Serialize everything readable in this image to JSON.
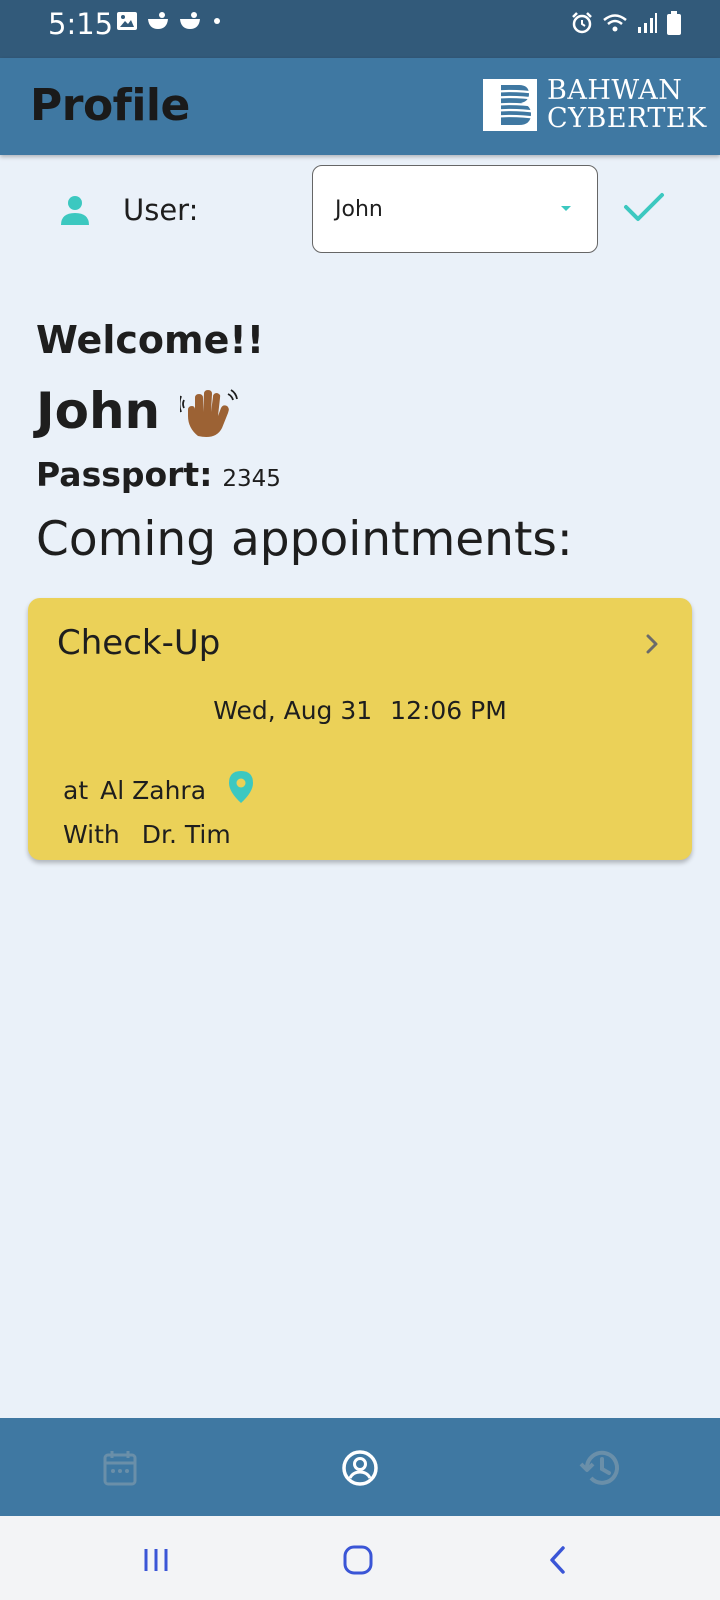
{
  "status_bar": {
    "time": "5:15",
    "icons_left": [
      "image-icon",
      "notification-app-icon",
      "notification-app-icon",
      "more-dot-icon"
    ],
    "icons_right": [
      "alarm-icon",
      "wifi-icon",
      "signal-icon",
      "battery-icon"
    ]
  },
  "app_bar": {
    "title": "Profile",
    "logo_line1": "BAHWAN",
    "logo_line2": "CYBERTEK"
  },
  "user_select": {
    "label": "User:",
    "selected": "John",
    "icon": "person-icon",
    "confirm_icon": "check-icon"
  },
  "welcome": {
    "greeting": "Welcome!!",
    "name": "John",
    "emoji_icon": "waving-hand-icon",
    "passport_label": "Passport:",
    "passport_value": "2345",
    "section_title": "Coming appointments:"
  },
  "appointments": [
    {
      "type": "Check-Up",
      "date": "Wed, Aug 31",
      "time": "12:06 PM",
      "location_prefix": "at",
      "location": "Al Zahra",
      "doctor_prefix": "With",
      "doctor": "Dr. Tim"
    }
  ],
  "bottom_nav": {
    "items": [
      "calendar-icon",
      "account-circle-icon",
      "history-icon"
    ],
    "active": "account-circle-icon"
  },
  "colors": {
    "status_bar": "#325a7a",
    "app_bar": "#3f78a2",
    "background": "#eaf1f9",
    "card": "#ebd158",
    "accent": "#3cc8c0",
    "system_nav_icons": "#3a55d6"
  }
}
